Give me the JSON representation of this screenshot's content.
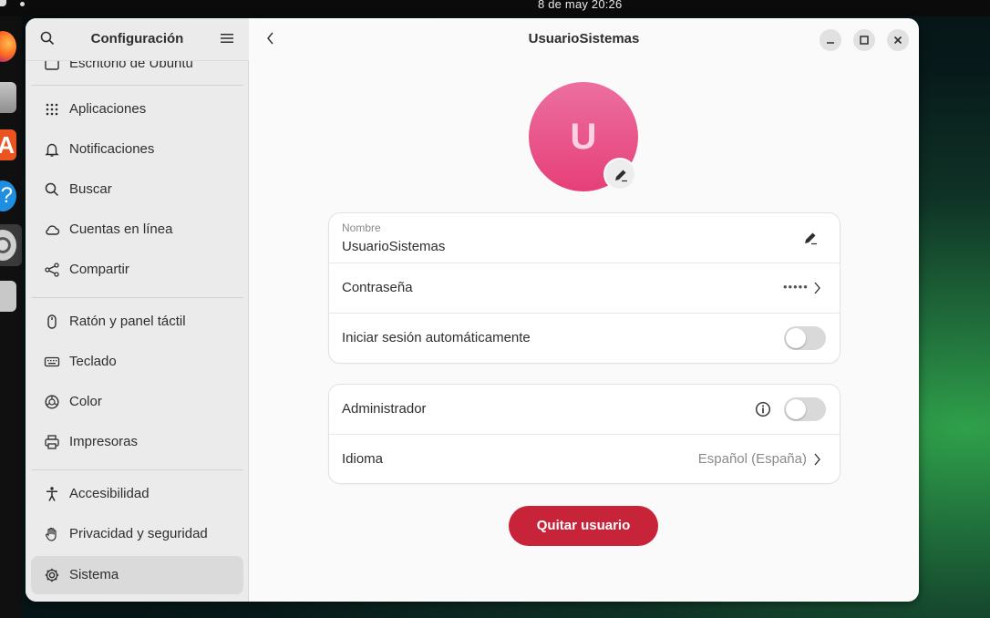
{
  "topbar": {
    "clock": "8 de may  20:26"
  },
  "sidebar": {
    "title": "Configuración",
    "partial_item": "Escritorio de Ubuntu",
    "items": [
      {
        "label": "Aplicaciones",
        "icon": "grid-icon"
      },
      {
        "label": "Notificaciones",
        "icon": "bell-icon"
      },
      {
        "label": "Buscar",
        "icon": "search-icon"
      },
      {
        "label": "Cuentas en línea",
        "icon": "cloud-icon"
      },
      {
        "label": "Compartir",
        "icon": "share-icon"
      },
      {
        "label": "Ratón y panel táctil",
        "icon": "mouse-icon"
      },
      {
        "label": "Teclado",
        "icon": "keyboard-icon"
      },
      {
        "label": "Color",
        "icon": "color-icon"
      },
      {
        "label": "Impresoras",
        "icon": "printer-icon"
      },
      {
        "label": "Accesibilidad",
        "icon": "accessibility-icon"
      },
      {
        "label": "Privacidad y seguridad",
        "icon": "hand-icon"
      },
      {
        "label": "Sistema",
        "icon": "gear-icon",
        "active": true
      }
    ]
  },
  "main": {
    "title": "UsuarioSistemas",
    "avatar_letter": "U",
    "name_label": "Nombre",
    "name_value": "UsuarioSistemas",
    "password_label": "Contraseña",
    "password_dots": "•••••",
    "autologin_label": "Iniciar sesión automáticamente",
    "autologin_on": false,
    "admin_label": "Administrador",
    "admin_on": false,
    "language_label": "Idioma",
    "language_value": "Español (España)",
    "remove_button": "Quitar usuario"
  },
  "colors": {
    "accent_red": "#c7243a",
    "avatar_pink": "#e63f78"
  }
}
